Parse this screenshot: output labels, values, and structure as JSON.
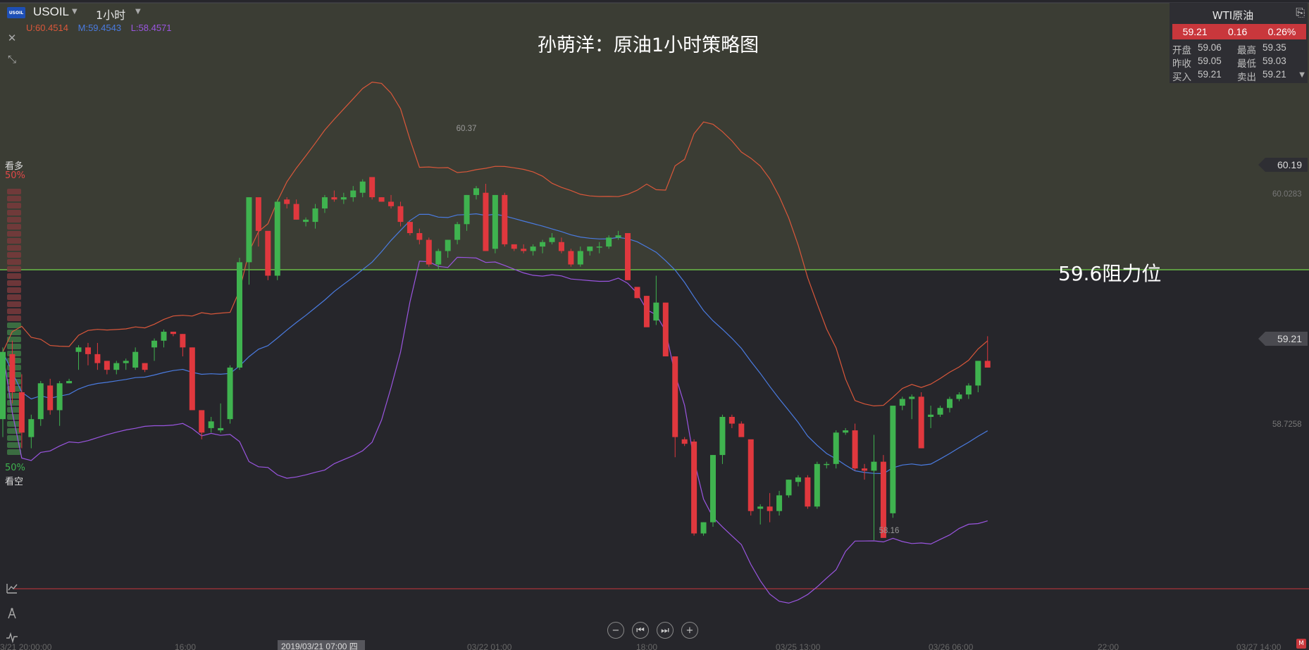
{
  "header": {
    "symbol_badge": "USOIL",
    "symbol": "USOIL",
    "interval": "1小时",
    "bb_upper": "U:60.4514",
    "bb_middle": "M:59.4543",
    "bb_lower": "L:58.4571"
  },
  "chart_title": "孙萌洋：原油1小时策略图",
  "resistance_label": "59.6阻力位",
  "sentiment": {
    "bull_label": "看多",
    "bull_pct": "50%",
    "bear_pct": "50%",
    "bear_label": "看空"
  },
  "quote": {
    "title": "WTI原油",
    "price": "59.21",
    "change": "0.16",
    "change_pct": "0.26%",
    "open_label": "开盘",
    "open": "59.06",
    "high_label": "最高",
    "high": "59.35",
    "prev_label": "昨收",
    "prev": "59.05",
    "low_label": "最低",
    "low": "59.03",
    "bid_label": "买入",
    "bid": "59.21",
    "ask_label": "卖出",
    "ask": "59.21"
  },
  "price_axis": {
    "tag_upper": "60.19",
    "tag_current": "59.21",
    "label_a": "60.0283",
    "label_b": "58.7258"
  },
  "annotations": {
    "high_point": "60.37",
    "low_point": "58.16"
  },
  "xaxis": {
    "labels": [
      "3/21 20:00:00",
      "16:00",
      "03/22 01:00",
      "18:00",
      "03/25 13:00",
      "03/26 06:00",
      "22:00",
      "03/27 14:00"
    ],
    "crosshair_label": "2019/03/21 07:00 四"
  },
  "colors": {
    "bull": "#3fb34f",
    "bear": "#e0383e",
    "bb_upper": "#d9573a",
    "bb_middle": "#4a7be0",
    "bb_lower": "#9a55e0",
    "resistance_line": "#6fd34a",
    "zone_fill": "#3b3d34"
  },
  "chart_data": {
    "type": "candlestick",
    "title": "孙萌洋：原油1小时策略图",
    "ylim": [
      57.95,
      60.85
    ],
    "resistance": 59.6,
    "resistance_label": "59.6阻力位",
    "indicator": "Bollinger Bands",
    "candles": [
      [
        58.98,
        59.3,
        58.9,
        59.28
      ],
      [
        59.27,
        59.33,
        59.05,
        59.1
      ],
      [
        59.1,
        59.18,
        58.85,
        58.92
      ],
      [
        58.9,
        59.0,
        58.85,
        58.98
      ],
      [
        58.98,
        59.15,
        58.95,
        59.14
      ],
      [
        59.13,
        59.16,
        59.0,
        59.02
      ],
      [
        59.02,
        59.15,
        58.95,
        59.14
      ],
      [
        59.14,
        59.16,
        59.14,
        59.15
      ],
      [
        59.28,
        59.31,
        59.2,
        59.3
      ],
      [
        59.3,
        59.32,
        59.22,
        59.27
      ],
      [
        59.27,
        59.32,
        59.2,
        59.23
      ],
      [
        59.24,
        59.24,
        59.18,
        59.2
      ],
      [
        59.2,
        59.24,
        59.18,
        59.23
      ],
      [
        59.23,
        59.25,
        59.2,
        59.24
      ],
      [
        59.21,
        59.3,
        59.2,
        59.28
      ],
      [
        59.23,
        59.23,
        59.19,
        59.2
      ],
      [
        59.3,
        59.34,
        59.24,
        59.33
      ],
      [
        59.33,
        59.38,
        59.3,
        59.37
      ],
      [
        59.37,
        59.37,
        59.35,
        59.36
      ],
      [
        59.36,
        59.36,
        59.26,
        59.3
      ],
      [
        59.3,
        59.3,
        59.05,
        59.02
      ],
      [
        59.02,
        59.02,
        58.89,
        58.92
      ],
      [
        58.94,
        58.99,
        58.92,
        58.97
      ],
      [
        58.93,
        59.05,
        58.92,
        58.94
      ],
      [
        58.98,
        59.22,
        58.96,
        59.21
      ],
      [
        59.21,
        59.7,
        59.2,
        59.68
      ],
      [
        59.68,
        59.97,
        59.58,
        59.97
      ],
      [
        59.97,
        59.95,
        59.75,
        59.82
      ],
      [
        59.82,
        59.75,
        59.6,
        59.62
      ],
      [
        59.62,
        59.96,
        59.6,
        59.95
      ],
      [
        59.96,
        59.97,
        59.92,
        59.94
      ],
      [
        59.94,
        59.96,
        59.87,
        59.87
      ],
      [
        59.86,
        59.88,
        59.84,
        59.87
      ],
      [
        59.86,
        59.94,
        59.83,
        59.92
      ],
      [
        59.92,
        59.98,
        59.9,
        59.97
      ],
      [
        59.97,
        60.0,
        59.95,
        59.96
      ],
      [
        59.96,
        59.99,
        59.94,
        59.97
      ],
      [
        59.97,
        60.02,
        59.95,
        60.0
      ],
      [
        59.99,
        60.05,
        59.97,
        60.04
      ],
      [
        60.06,
        60.04,
        59.96,
        59.97
      ],
      [
        59.97,
        59.97,
        59.95,
        59.95
      ],
      [
        59.95,
        59.98,
        59.92,
        59.93
      ],
      [
        59.93,
        59.95,
        59.84,
        59.86
      ],
      [
        59.86,
        59.86,
        59.8,
        59.81
      ],
      [
        59.81,
        59.83,
        59.76,
        59.78
      ],
      [
        59.78,
        59.79,
        59.66,
        59.67
      ],
      [
        59.67,
        59.74,
        59.65,
        59.73
      ],
      [
        59.73,
        59.78,
        59.7,
        59.78
      ],
      [
        59.78,
        59.86,
        59.76,
        59.85
      ],
      [
        59.85,
        59.98,
        59.82,
        59.98
      ],
      [
        59.98,
        60.02,
        59.96,
        60.01
      ],
      [
        59.99,
        60.03,
        59.73,
        59.73
      ],
      [
        59.74,
        59.98,
        59.72,
        59.98
      ],
      [
        59.98,
        59.99,
        59.75,
        59.76
      ],
      [
        59.76,
        59.76,
        59.73,
        59.74
      ],
      [
        59.74,
        59.76,
        59.72,
        59.73
      ],
      [
        59.73,
        59.76,
        59.71,
        59.75
      ],
      [
        59.75,
        59.78,
        59.72,
        59.77
      ],
      [
        59.77,
        59.81,
        59.76,
        59.79
      ],
      [
        59.77,
        59.79,
        59.72,
        59.73
      ],
      [
        59.73,
        59.74,
        59.66,
        59.67
      ],
      [
        59.67,
        59.75,
        59.66,
        59.73
      ],
      [
        59.73,
        59.75,
        59.71,
        59.75
      ],
      [
        59.75,
        59.77,
        59.72,
        59.75
      ],
      [
        59.75,
        59.8,
        59.74,
        59.79
      ],
      [
        59.79,
        59.82,
        59.78,
        59.8
      ],
      [
        59.81,
        59.79,
        59.6,
        59.6
      ],
      [
        59.57,
        59.56,
        59.52,
        59.52
      ],
      [
        59.53,
        59.53,
        59.4,
        59.39
      ],
      [
        59.42,
        59.62,
        59.4,
        59.5
      ],
      [
        59.5,
        59.44,
        59.27,
        59.26
      ],
      [
        59.26,
        59.26,
        58.81,
        58.9
      ],
      [
        58.89,
        58.9,
        58.86,
        58.87
      ],
      [
        58.88,
        58.89,
        58.46,
        58.47
      ],
      [
        58.47,
        58.52,
        58.46,
        58.52
      ],
      [
        58.52,
        58.82,
        58.5,
        58.82
      ],
      [
        58.82,
        59.0,
        58.78,
        58.99
      ],
      [
        58.99,
        59.0,
        58.94,
        58.96
      ],
      [
        58.96,
        58.97,
        58.91,
        58.9
      ],
      [
        58.89,
        58.88,
        58.55,
        58.57
      ],
      [
        58.58,
        58.6,
        58.51,
        58.59
      ],
      [
        58.59,
        58.65,
        58.52,
        58.57
      ],
      [
        58.57,
        58.66,
        58.55,
        58.64
      ],
      [
        58.64,
        58.71,
        58.63,
        58.71
      ],
      [
        58.7,
        58.73,
        58.68,
        58.72
      ],
      [
        58.72,
        58.73,
        58.58,
        58.59
      ],
      [
        58.59,
        58.79,
        58.58,
        58.78
      ],
      [
        58.78,
        58.79,
        58.76,
        58.78
      ],
      [
        58.78,
        58.93,
        58.76,
        58.92
      ],
      [
        58.92,
        58.94,
        58.91,
        58.93
      ],
      [
        58.93,
        58.96,
        58.75,
        58.76
      ],
      [
        58.76,
        58.78,
        58.71,
        58.75
      ],
      [
        58.75,
        58.91,
        58.44,
        58.79
      ],
      [
        58.79,
        58.82,
        58.5,
        58.45
      ],
      [
        58.56,
        59.04,
        58.54,
        59.04
      ],
      [
        59.04,
        59.08,
        59.02,
        59.07
      ],
      [
        59.07,
        59.09,
        58.98,
        59.08
      ],
      [
        59.08,
        59.1,
        58.85,
        58.85
      ],
      [
        58.99,
        59.04,
        58.94,
        59.0
      ],
      [
        59.0,
        59.04,
        58.99,
        59.03
      ],
      [
        59.03,
        59.08,
        59.01,
        59.07
      ],
      [
        59.07,
        59.1,
        59.06,
        59.09
      ],
      [
        59.09,
        59.14,
        59.07,
        59.13
      ],
      [
        59.13,
        59.24,
        59.1,
        59.24
      ],
      [
        59.24,
        59.35,
        59.21,
        59.21
      ]
    ],
    "annotations": [
      {
        "text": "60.37",
        "value": 60.37
      },
      {
        "text": "58.16",
        "value": 58.16
      }
    ]
  }
}
